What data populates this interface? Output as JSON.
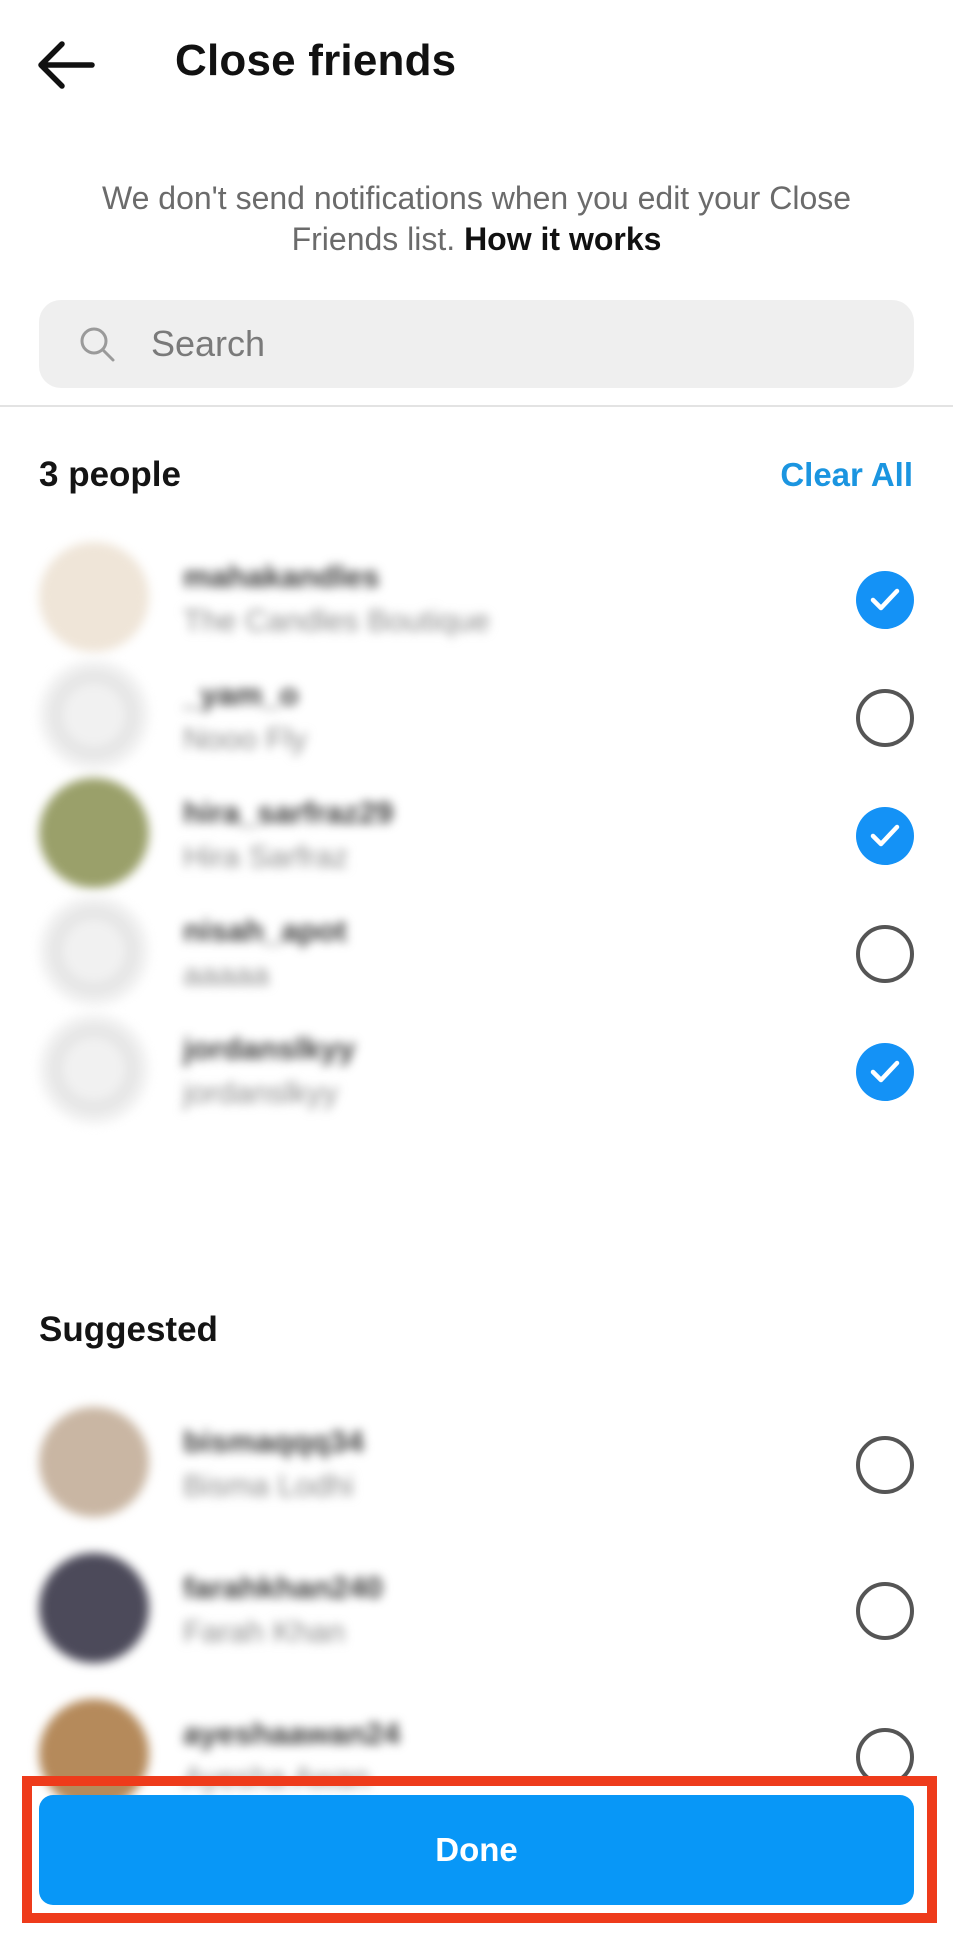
{
  "header": {
    "title": "Close friends",
    "back_icon": "arrow-left-icon"
  },
  "notice": {
    "text": "We don't send notifications when you edit your Close Friends list.",
    "link": "How it works"
  },
  "search": {
    "placeholder": "Search",
    "value": "",
    "icon": "search-icon"
  },
  "close_friends": {
    "count_label": "3 people",
    "clear_label": "Clear All",
    "items": [
      {
        "username": "mahakandles",
        "full_name": "The Candles Boutique",
        "selected": true,
        "avatar_color": "#efe5d8"
      },
      {
        "username": "_yam_o",
        "full_name": "Nooo Fly",
        "selected": false,
        "avatar_color": "#f1f1f1"
      },
      {
        "username": "hira_sarfraz29",
        "full_name": "Hira Sarfraz",
        "selected": true,
        "avatar_color": "#9aa06a"
      },
      {
        "username": "nisah_apot",
        "full_name": "aaaaa",
        "selected": false,
        "avatar_color": "#f1f1f1"
      },
      {
        "username": "jordanslkyy",
        "full_name": "jordanslkyy",
        "selected": true,
        "avatar_color": "#f1f1f1"
      }
    ]
  },
  "suggested": {
    "label": "Suggested",
    "items": [
      {
        "username": "bismaqqq34",
        "full_name": "Bisma Lodhi",
        "selected": false,
        "avatar_color": "#c9b6a3"
      },
      {
        "username": "farahkhan240",
        "full_name": "Farah Khan",
        "selected": false,
        "avatar_color": "#4c4a5a"
      },
      {
        "username": "ayeshaawan24",
        "full_name": "Ayesha Awan",
        "selected": false,
        "avatar_color": "#b58a5b"
      }
    ]
  },
  "footer": {
    "done_label": "Done"
  },
  "colors": {
    "accent": "#1492f6",
    "done_button": "#0897f7",
    "link_blue": "#1b95e0",
    "highlight_frame": "#ee3b1b"
  }
}
